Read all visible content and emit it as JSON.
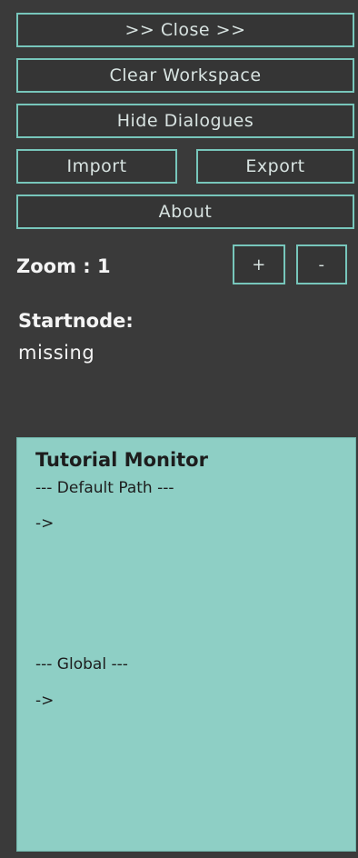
{
  "controls": {
    "close_label": ">> Close >>",
    "clear_label": "Clear Workspace",
    "hide_label": "Hide Dialogues",
    "import_label": "Import",
    "export_label": "Export",
    "about_label": "About"
  },
  "zoom": {
    "label": "Zoom : 1",
    "in_label": "+",
    "out_label": "-"
  },
  "startnode": {
    "label": "Startnode:",
    "value": "missing"
  },
  "tutorial_monitor": {
    "title": "Tutorial Monitor",
    "default_path_header": "--- Default Path ---",
    "default_path_arrow": "->",
    "global_header": "--- Global ---",
    "global_arrow": "->"
  },
  "colors": {
    "background": "#3a3a3a",
    "accent": "#77c6bb",
    "monitor_bg": "#8ecfc5"
  }
}
